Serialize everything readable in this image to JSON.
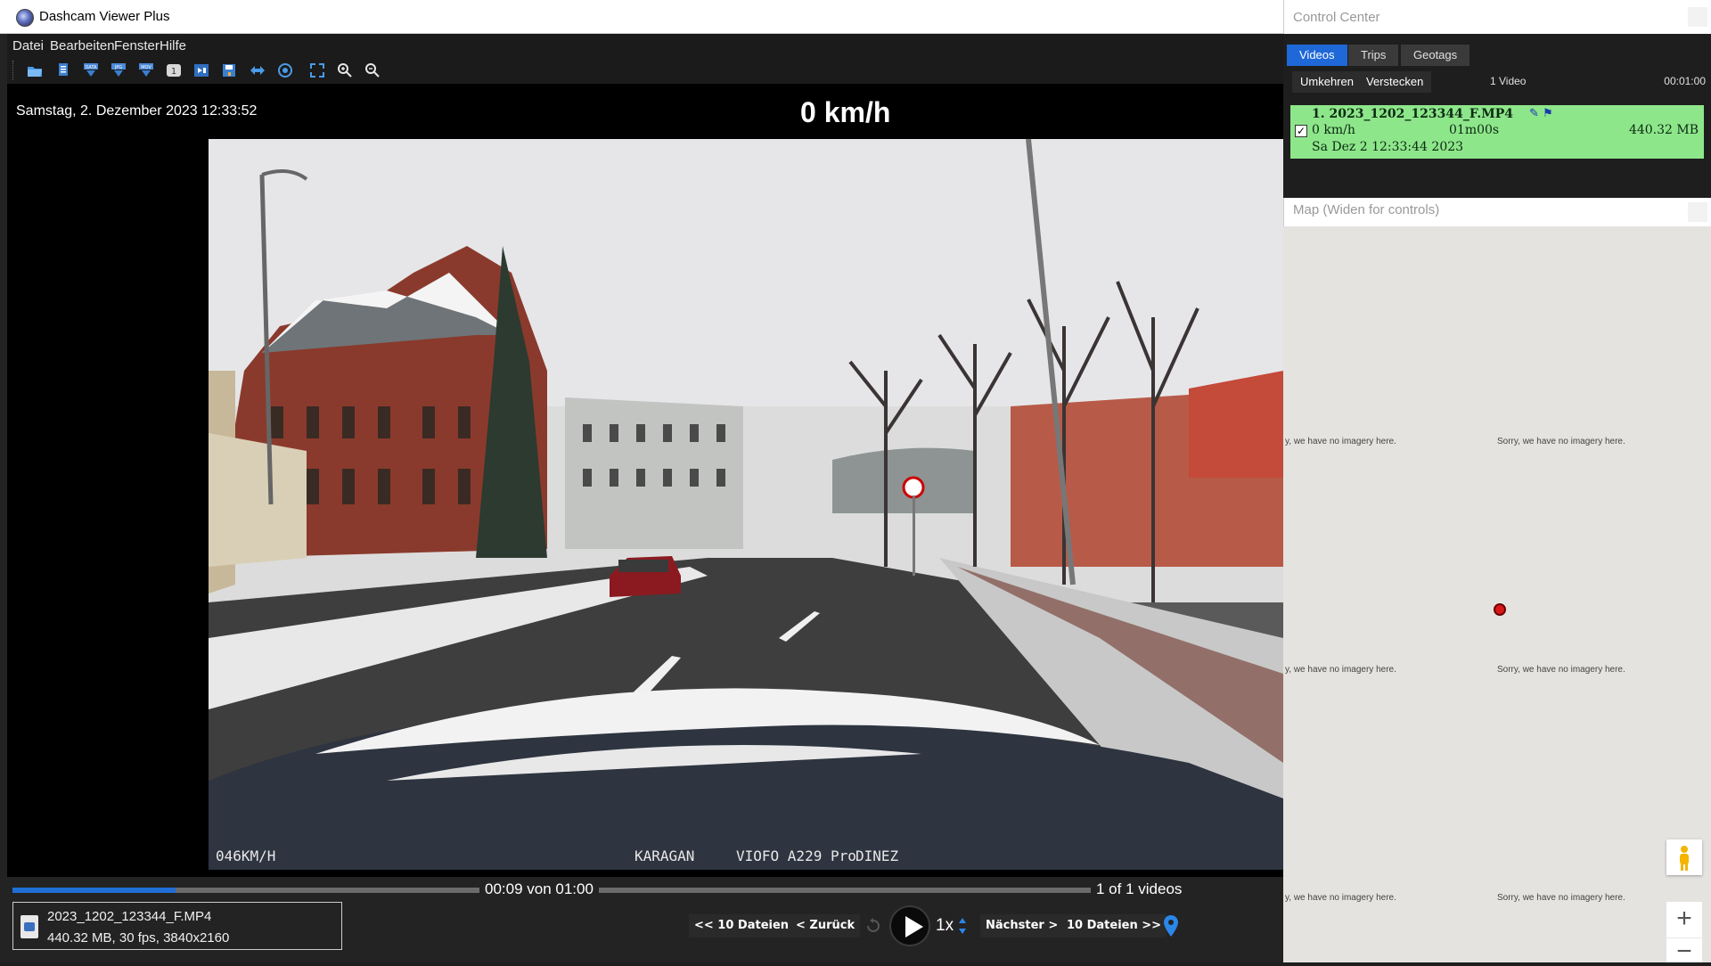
{
  "app": {
    "title": "Dashcam Viewer Plus",
    "menu": [
      "Datei",
      "Bearbeiten",
      "Fenster",
      "Hilfe"
    ],
    "toolbar_icons": [
      "open-folder-icon",
      "open-files-icon",
      "export-data-icon",
      "export-jpg-icon",
      "export-mov-icon",
      "one-icon",
      "export-clip-icon",
      "save-icon",
      "fit-width-icon",
      "circle-icon",
      "fullscreen-icon",
      "zoom-in-icon",
      "zoom-out-icon"
    ]
  },
  "overlay": {
    "date": "Samstag, 2. Dezember 2023 12:33:52",
    "speed": "0 km/h"
  },
  "video_osd": {
    "speed": "046KM/H",
    "location": "KARAGAN",
    "model": "VIOFO A229 Pro",
    "place": "DINEZ"
  },
  "playback": {
    "progress": 0.15,
    "time": "00:09 von 01:00",
    "count": "1 of 1 videos",
    "file_name": "2023_1202_123344_F.MP4",
    "file_meta": "440.32 MB, 30 fps, 3840x2160",
    "prev10": "<< 10 Dateien",
    "prev": "< Zurück",
    "speed": "1x",
    "next": "Nächster >",
    "next10": "10 Dateien >>"
  },
  "control_center": {
    "title": "Control Center",
    "tabs": [
      "Videos",
      "Trips",
      "Geotags"
    ],
    "active_tab": 0,
    "buttons": [
      "Umkehren",
      "Verstecken"
    ],
    "count": "1 Video",
    "duration": "00:01:00",
    "entry": {
      "title": "1. 2023_1202_123344_F.MP4",
      "speed": "0  km/h",
      "duration": "01m00s",
      "size": "440.32 MB",
      "date": "Sa Dez 2 12:33:44 2023",
      "checked": true,
      "color": "#8ee68a"
    }
  },
  "map": {
    "title": "Map (Widen for controls)",
    "no_imagery": "Sorry, we have no imagery here.",
    "no_imagery_cut": "y, we have no imagery here.",
    "zoom_in": "+",
    "zoom_out": "−"
  },
  "colors": {
    "accent": "#1e68d8",
    "progress": "#1f6fd6",
    "marker": "#d81818"
  }
}
